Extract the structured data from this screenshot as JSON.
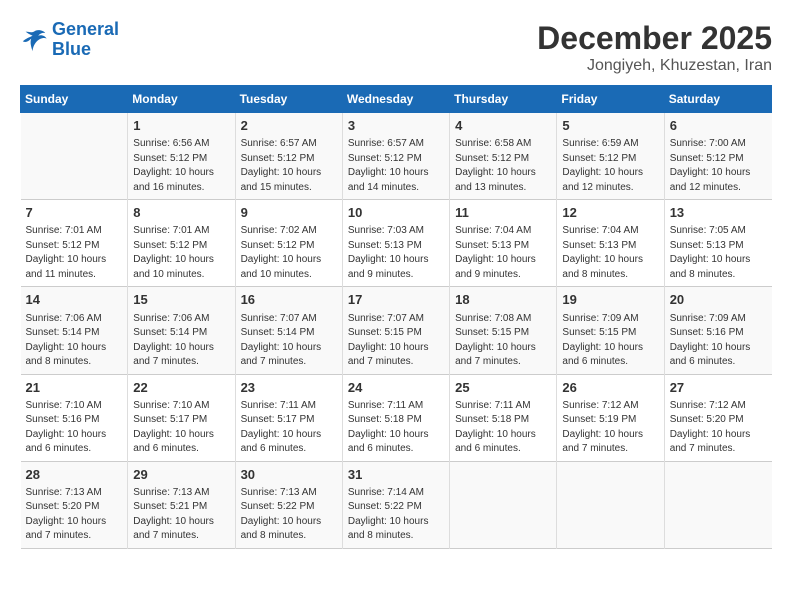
{
  "logo": {
    "line1": "General",
    "line2": "Blue"
  },
  "title": "December 2025",
  "location": "Jongiyeh, Khuzestan, Iran",
  "days_header": [
    "Sunday",
    "Monday",
    "Tuesday",
    "Wednesday",
    "Thursday",
    "Friday",
    "Saturday"
  ],
  "weeks": [
    [
      {
        "day": "",
        "info": ""
      },
      {
        "day": "1",
        "info": "Sunrise: 6:56 AM\nSunset: 5:12 PM\nDaylight: 10 hours\nand 16 minutes."
      },
      {
        "day": "2",
        "info": "Sunrise: 6:57 AM\nSunset: 5:12 PM\nDaylight: 10 hours\nand 15 minutes."
      },
      {
        "day": "3",
        "info": "Sunrise: 6:57 AM\nSunset: 5:12 PM\nDaylight: 10 hours\nand 14 minutes."
      },
      {
        "day": "4",
        "info": "Sunrise: 6:58 AM\nSunset: 5:12 PM\nDaylight: 10 hours\nand 13 minutes."
      },
      {
        "day": "5",
        "info": "Sunrise: 6:59 AM\nSunset: 5:12 PM\nDaylight: 10 hours\nand 12 minutes."
      },
      {
        "day": "6",
        "info": "Sunrise: 7:00 AM\nSunset: 5:12 PM\nDaylight: 10 hours\nand 12 minutes."
      }
    ],
    [
      {
        "day": "7",
        "info": "Sunrise: 7:01 AM\nSunset: 5:12 PM\nDaylight: 10 hours\nand 11 minutes."
      },
      {
        "day": "8",
        "info": "Sunrise: 7:01 AM\nSunset: 5:12 PM\nDaylight: 10 hours\nand 10 minutes."
      },
      {
        "day": "9",
        "info": "Sunrise: 7:02 AM\nSunset: 5:12 PM\nDaylight: 10 hours\nand 10 minutes."
      },
      {
        "day": "10",
        "info": "Sunrise: 7:03 AM\nSunset: 5:13 PM\nDaylight: 10 hours\nand 9 minutes."
      },
      {
        "day": "11",
        "info": "Sunrise: 7:04 AM\nSunset: 5:13 PM\nDaylight: 10 hours\nand 9 minutes."
      },
      {
        "day": "12",
        "info": "Sunrise: 7:04 AM\nSunset: 5:13 PM\nDaylight: 10 hours\nand 8 minutes."
      },
      {
        "day": "13",
        "info": "Sunrise: 7:05 AM\nSunset: 5:13 PM\nDaylight: 10 hours\nand 8 minutes."
      }
    ],
    [
      {
        "day": "14",
        "info": "Sunrise: 7:06 AM\nSunset: 5:14 PM\nDaylight: 10 hours\nand 8 minutes."
      },
      {
        "day": "15",
        "info": "Sunrise: 7:06 AM\nSunset: 5:14 PM\nDaylight: 10 hours\nand 7 minutes."
      },
      {
        "day": "16",
        "info": "Sunrise: 7:07 AM\nSunset: 5:14 PM\nDaylight: 10 hours\nand 7 minutes."
      },
      {
        "day": "17",
        "info": "Sunrise: 7:07 AM\nSunset: 5:15 PM\nDaylight: 10 hours\nand 7 minutes."
      },
      {
        "day": "18",
        "info": "Sunrise: 7:08 AM\nSunset: 5:15 PM\nDaylight: 10 hours\nand 7 minutes."
      },
      {
        "day": "19",
        "info": "Sunrise: 7:09 AM\nSunset: 5:15 PM\nDaylight: 10 hours\nand 6 minutes."
      },
      {
        "day": "20",
        "info": "Sunrise: 7:09 AM\nSunset: 5:16 PM\nDaylight: 10 hours\nand 6 minutes."
      }
    ],
    [
      {
        "day": "21",
        "info": "Sunrise: 7:10 AM\nSunset: 5:16 PM\nDaylight: 10 hours\nand 6 minutes."
      },
      {
        "day": "22",
        "info": "Sunrise: 7:10 AM\nSunset: 5:17 PM\nDaylight: 10 hours\nand 6 minutes."
      },
      {
        "day": "23",
        "info": "Sunrise: 7:11 AM\nSunset: 5:17 PM\nDaylight: 10 hours\nand 6 minutes."
      },
      {
        "day": "24",
        "info": "Sunrise: 7:11 AM\nSunset: 5:18 PM\nDaylight: 10 hours\nand 6 minutes."
      },
      {
        "day": "25",
        "info": "Sunrise: 7:11 AM\nSunset: 5:18 PM\nDaylight: 10 hours\nand 6 minutes."
      },
      {
        "day": "26",
        "info": "Sunrise: 7:12 AM\nSunset: 5:19 PM\nDaylight: 10 hours\nand 7 minutes."
      },
      {
        "day": "27",
        "info": "Sunrise: 7:12 AM\nSunset: 5:20 PM\nDaylight: 10 hours\nand 7 minutes."
      }
    ],
    [
      {
        "day": "28",
        "info": "Sunrise: 7:13 AM\nSunset: 5:20 PM\nDaylight: 10 hours\nand 7 minutes."
      },
      {
        "day": "29",
        "info": "Sunrise: 7:13 AM\nSunset: 5:21 PM\nDaylight: 10 hours\nand 7 minutes."
      },
      {
        "day": "30",
        "info": "Sunrise: 7:13 AM\nSunset: 5:22 PM\nDaylight: 10 hours\nand 8 minutes."
      },
      {
        "day": "31",
        "info": "Sunrise: 7:14 AM\nSunset: 5:22 PM\nDaylight: 10 hours\nand 8 minutes."
      },
      {
        "day": "",
        "info": ""
      },
      {
        "day": "",
        "info": ""
      },
      {
        "day": "",
        "info": ""
      }
    ]
  ]
}
